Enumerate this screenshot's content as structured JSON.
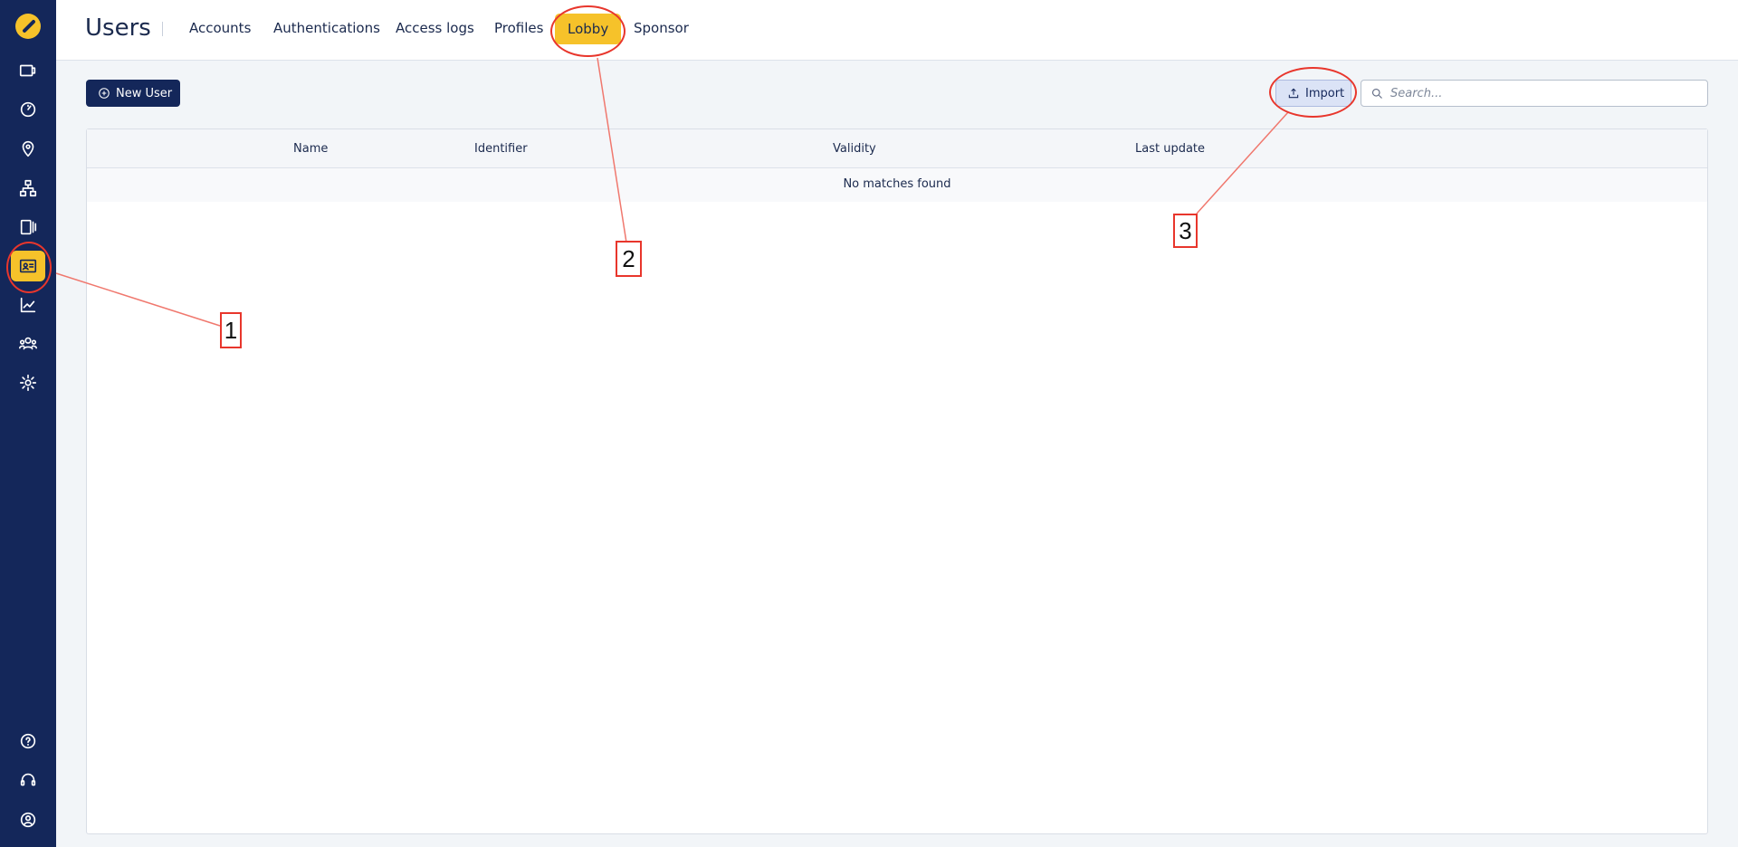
{
  "header": {
    "title": "Users",
    "tabs": [
      {
        "label": "Accounts"
      },
      {
        "label": "Authentications"
      },
      {
        "label": "Access logs"
      },
      {
        "label": "Profiles"
      },
      {
        "label": "Lobby",
        "active": true
      },
      {
        "label": "Sponsor"
      }
    ]
  },
  "sidebar": {
    "items": [
      {
        "icon": "ticket-icon"
      },
      {
        "icon": "dashboard-icon"
      },
      {
        "icon": "location-icon"
      },
      {
        "icon": "network-icon"
      },
      {
        "icon": "device-icon"
      },
      {
        "icon": "id-card-icon",
        "active": true
      },
      {
        "icon": "chart-icon"
      },
      {
        "icon": "users-icon"
      },
      {
        "icon": "gear-icon"
      },
      {
        "icon": "help-icon"
      },
      {
        "icon": "headset-icon"
      },
      {
        "icon": "account-icon"
      }
    ]
  },
  "toolbar": {
    "new_user_label": "New User",
    "import_label": "Import",
    "search_placeholder": "Search..."
  },
  "table": {
    "columns": [
      "Name",
      "Identifier",
      "Validity",
      "Last update"
    ],
    "empty_message": "No matches found"
  },
  "annotations": {
    "color": "#e8362c",
    "labels": [
      "1",
      "2",
      "3"
    ]
  },
  "colors": {
    "sidebar": "#14275a",
    "accent": "#f6c22a",
    "primary_button": "#14275a"
  }
}
